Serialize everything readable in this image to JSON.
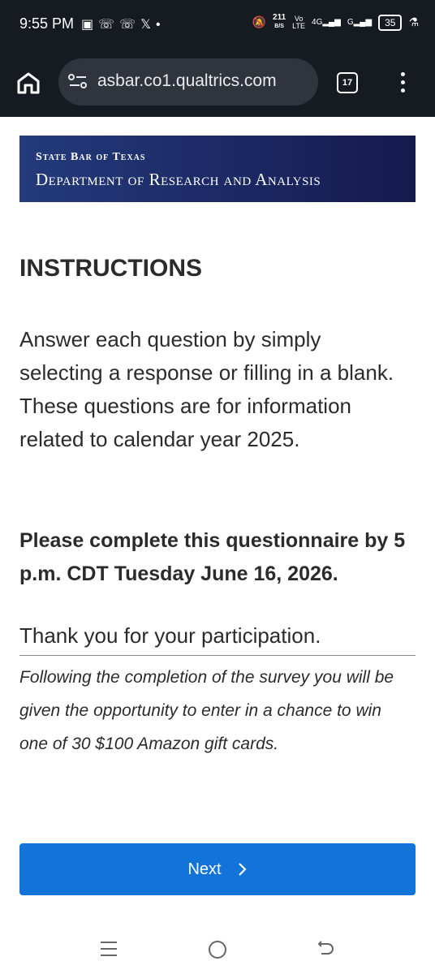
{
  "status_bar": {
    "time": "9:55 PM",
    "net_speed_value": "211",
    "net_speed_unit": "B/S",
    "battery": "35"
  },
  "browser": {
    "url": "asbar.co1.qualtrics.com",
    "tab_count": "17"
  },
  "banner": {
    "line1": "State Bar of Texas",
    "line2": "Department of Research and Analysis"
  },
  "content": {
    "heading": "INSTRUCTIONS",
    "paragraph": "Answer each question by simply selecting a response or filling in a blank. These questions are for information related to calendar year 2025.",
    "deadline": "Please complete this questionnaire by 5 p.m. CDT Tuesday June 16, 2026.",
    "thanks": "Thank you for your participation.",
    "note": "Following the completion of the survey you will be given the opportunity to enter in a chance to win one of 30 $100 Amazon gift cards."
  },
  "next_button": {
    "label": "Next"
  },
  "colors": {
    "accent": "#1273d8",
    "banner": "#1c2a66",
    "browser_chrome": "#161b22"
  }
}
